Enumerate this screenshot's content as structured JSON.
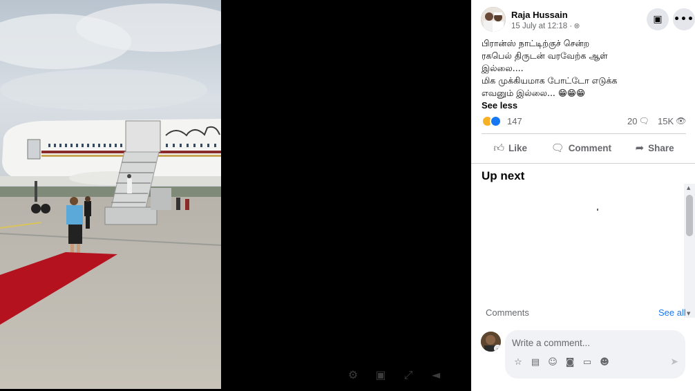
{
  "post": {
    "author": "Raja Hussain",
    "timestamp": "15 July at 12:18",
    "privacy_icon": "globe-icon",
    "text_lines": [
      "பிரான்ஸ் நாட்டிற்குச் சென்ற",
      "ரகபெல் திருடன் வரவேற்க ஆள்",
      "இல்லை....",
      "மிக முக்கியமாக போட்டோ எடுக்க",
      "எவனும் இல்லை... 😁😁😁"
    ],
    "see_less": "See less",
    "reactions_count": "147",
    "comments_count": "20",
    "views_count": "15K"
  },
  "actions": {
    "like": "Like",
    "comment": "Comment",
    "share": "Share"
  },
  "up_next": {
    "title": "Up next"
  },
  "comments": {
    "heading": "Comments",
    "see_all": "See all",
    "placeholder": "Write a comment..."
  },
  "colors": {
    "accent": "#1877f2",
    "secondary_text": "#65676b",
    "red_carpet": "#b3121e"
  }
}
